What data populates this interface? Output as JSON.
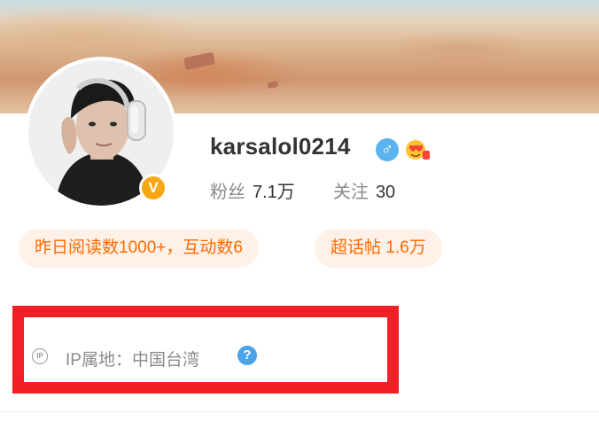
{
  "profile": {
    "username": "karsalol0214",
    "verified_badge": "V",
    "gender_symbol": "♂",
    "icons": {
      "gender": "male-gender-icon",
      "emoji": "heart-eyes-emoji-icon",
      "verified": "verified-v-badge-icon",
      "ip": "ip-location-icon",
      "help": "question-help-icon"
    }
  },
  "stats": {
    "followers_label": "粉丝",
    "followers_value": "7.1万",
    "following_label": "关注",
    "following_value": "30"
  },
  "pills": {
    "reads": "昨日阅读数1000+，互动数6",
    "supertopic": "超话帖 1.6万"
  },
  "info": {
    "partially_hidden_line": "",
    "ip_icon_text": "IP",
    "ip_location": "IP属地：中国台湾",
    "help_symbol": "?"
  },
  "colors": {
    "accent_orange": "#ff6a00",
    "pill_bg": "#fff1e8",
    "highlight_red": "#f21f27",
    "gender_blue": "#5bb3ee",
    "help_blue": "#4aa3e8",
    "verified_gold": "#f7a713"
  }
}
